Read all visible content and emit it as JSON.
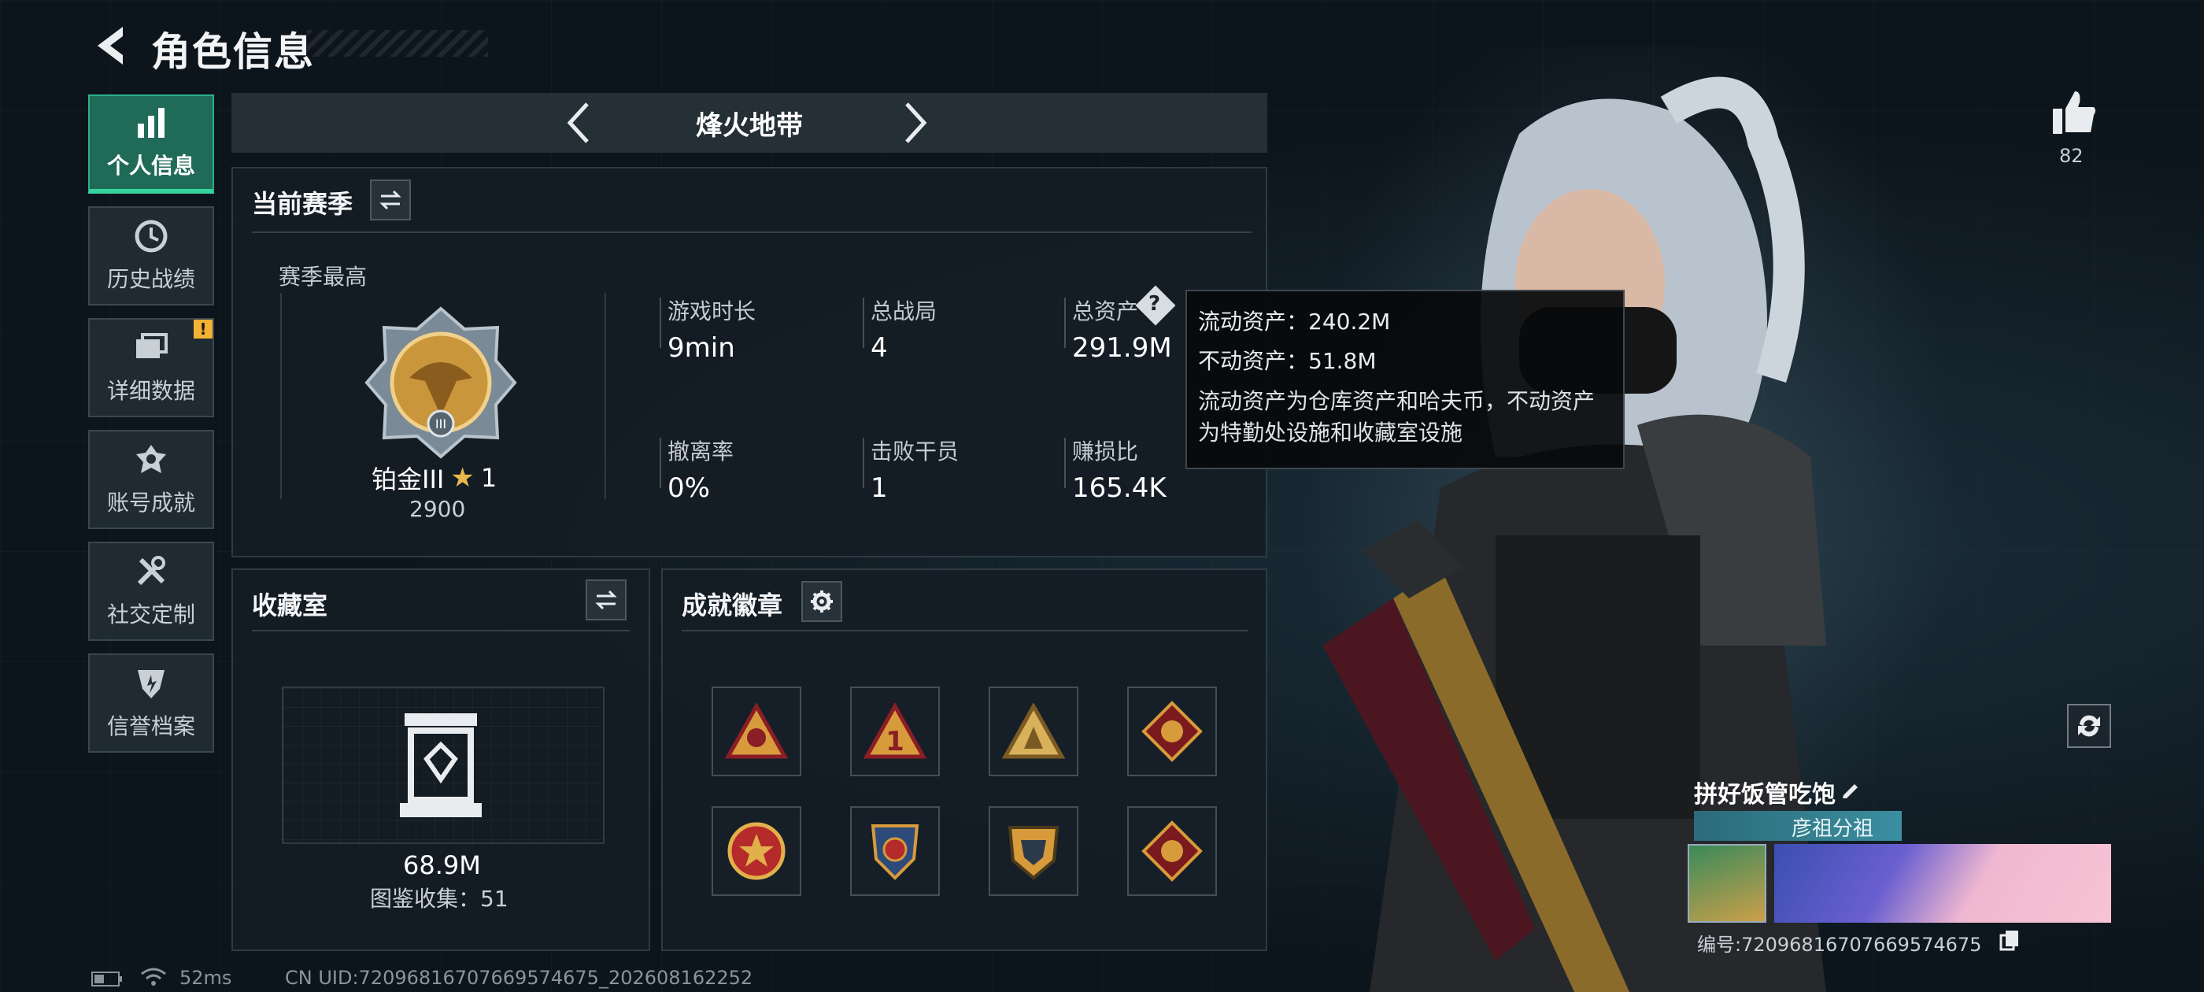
{
  "header": {
    "title": "角色信息"
  },
  "sidebar": {
    "items": [
      {
        "label": "个人信息",
        "icon": "bar-chart-icon",
        "active": true
      },
      {
        "label": "历史战绩",
        "icon": "history-clock-icon"
      },
      {
        "label": "详细数据",
        "icon": "folder-icon",
        "warning": "!"
      },
      {
        "label": "账号成就",
        "icon": "achievement-icon"
      },
      {
        "label": "社交定制",
        "icon": "tools-icon"
      },
      {
        "label": "信誉档案",
        "icon": "credit-shield-icon"
      }
    ]
  },
  "mode_switch": {
    "mode": "烽火地带"
  },
  "season": {
    "title": "当前赛季",
    "best_label": "赛季最高",
    "rank_name": "铂金III",
    "rank_stars": "1",
    "rank_points": "2900",
    "stats": [
      {
        "label": "游戏时长",
        "value": "9min"
      },
      {
        "label": "总战局",
        "value": "4"
      },
      {
        "label": "总资产",
        "value": "291.9M"
      },
      {
        "label": "撤离率",
        "value": "0%"
      },
      {
        "label": "击败干员",
        "value": "1"
      },
      {
        "label": "赚损比",
        "value": "165.4K"
      }
    ]
  },
  "tooltip": {
    "liquid": "流动资产：240.2M",
    "fixed": "不动资产：51.8M",
    "description": "流动资产为仓库资产和哈夫币，不动资产为特勤处设施和收藏室设施"
  },
  "collection": {
    "title": "收藏室",
    "value": "68.9M",
    "catalog": "图鉴收集：51"
  },
  "badges": {
    "title": "成就徽章"
  },
  "profile": {
    "likes": "82",
    "name": "拼好饭管吃饱",
    "tag": "彦祖分祖",
    "id_text": "编号:720968167076695746​75"
  },
  "footer": {
    "ping": "52ms",
    "uid": "CN UID:72096816707669574675_202608162252"
  },
  "colors": {
    "accent": "#37d39d",
    "active_bg": "#1f6b57",
    "badge_gold": "#c9963c"
  }
}
